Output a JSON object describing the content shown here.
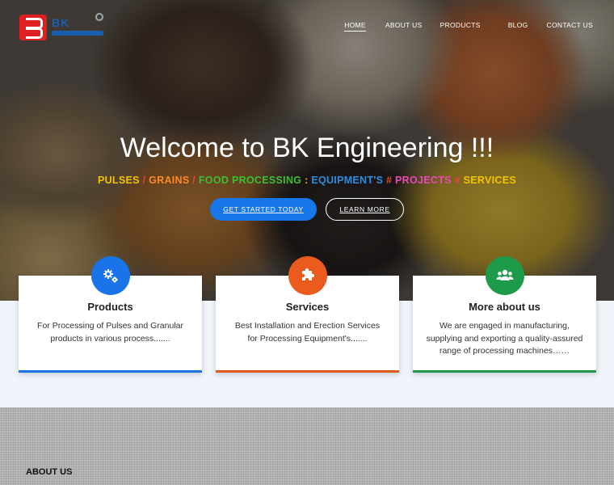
{
  "brand": {
    "logo_text": "BK",
    "logo_mark_letter": "B"
  },
  "nav": {
    "items": [
      {
        "label": "HOME",
        "active": true
      },
      {
        "label": "ABOUT US",
        "active": false
      },
      {
        "label": "PRODUCTS",
        "active": false
      },
      {
        "label": "BLOG",
        "active": false
      },
      {
        "label": "CONTACT US",
        "active": false
      }
    ]
  },
  "hero": {
    "title": "Welcome to BK Engineering !!!",
    "tagline": {
      "pulses": "PULSES",
      "sep1": " / ",
      "grains": "GRAINS",
      "sep2": " / ",
      "food": "FOOD PROCESSING",
      "sep3": " : ",
      "equipment": "EQUIPMENT'S",
      "hash1": " # ",
      "projects": "PROJECTS",
      "hash2": " # ",
      "services": "SERVICES"
    },
    "primary_button": "GET STARTED TODAY",
    "secondary_button": "LEARN MORE"
  },
  "cards": [
    {
      "title": "Products",
      "text": "For Processing of Pulses and Granular products in various process.......",
      "icon": "gears-icon",
      "color": "#1a73e8"
    },
    {
      "title": "Services",
      "text": "Best Installation and Erection Services for Processing Equipment's.......",
      "icon": "puzzle-icon",
      "color": "#ec5b1e"
    },
    {
      "title": "More about us",
      "text": "We are engaged in manufacturing, supplying and exporting a quality-assured range of processing machines……",
      "icon": "users-icon",
      "color": "#1e9b4a"
    }
  ],
  "about": {
    "heading": "ABOUT US"
  }
}
